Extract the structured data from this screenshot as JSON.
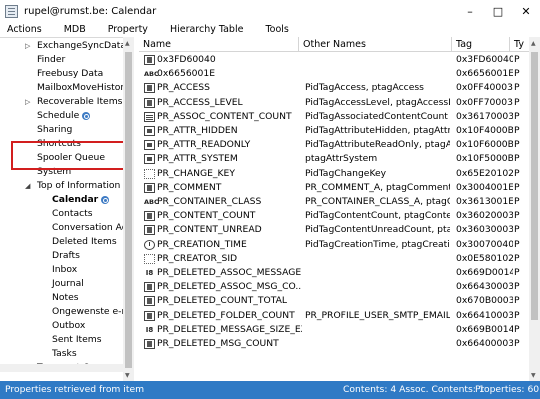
{
  "window": {
    "title": "rupel@rumst.be: Calendar",
    "icon": "mfcmapi-app-icon",
    "buttons": [
      "–",
      "□",
      "✕"
    ]
  },
  "menu": [
    "Actions",
    "MDB",
    "Property",
    "Hierarchy Table",
    "Tools"
  ],
  "tree": {
    "items": [
      {
        "label": "ExchangeSyncData",
        "indent": 1,
        "expander": "▷",
        "sync": false
      },
      {
        "label": "Finder",
        "indent": 1,
        "expander": "",
        "sync": false
      },
      {
        "label": "Freebusy Data",
        "indent": 1,
        "expander": "",
        "sync": false
      },
      {
        "label": "MailboxMoveHistory",
        "indent": 1,
        "expander": "",
        "sync": false
      },
      {
        "label": "Recoverable Items",
        "indent": 1,
        "expander": "▷",
        "sync": true
      },
      {
        "label": "Schedule",
        "indent": 1,
        "expander": "",
        "sync": true
      },
      {
        "label": "Sharing",
        "indent": 1,
        "expander": "",
        "sync": false
      },
      {
        "label": "Shortcuts",
        "indent": 1,
        "expander": "",
        "sync": false
      },
      {
        "label": "Spooler Queue",
        "indent": 1,
        "expander": "",
        "sync": false
      },
      {
        "label": "System",
        "indent": 1,
        "expander": "",
        "sync": false
      },
      {
        "label": "Top of Information S",
        "indent": 1,
        "expander": "◢",
        "sync": false
      },
      {
        "label": "Calendar",
        "indent": 2,
        "expander": "",
        "sync": true,
        "selected": true
      },
      {
        "label": "Contacts",
        "indent": 2,
        "expander": "",
        "sync": false
      },
      {
        "label": "Conversation Acti",
        "indent": 2,
        "expander": "",
        "sync": false
      },
      {
        "label": "Deleted Items",
        "indent": 2,
        "expander": "",
        "sync": false
      },
      {
        "label": "Drafts",
        "indent": 2,
        "expander": "",
        "sync": false
      },
      {
        "label": "Inbox",
        "indent": 2,
        "expander": "",
        "sync": false
      },
      {
        "label": "Journal",
        "indent": 2,
        "expander": "",
        "sync": false
      },
      {
        "label": "Notes",
        "indent": 2,
        "expander": "",
        "sync": false
      },
      {
        "label": "Ongewenste e-m",
        "indent": 2,
        "expander": "",
        "sync": false
      },
      {
        "label": "Outbox",
        "indent": 2,
        "expander": "",
        "sync": false
      },
      {
        "label": "Sent Items",
        "indent": 2,
        "expander": "",
        "sync": false
      },
      {
        "label": "Tasks",
        "indent": 2,
        "expander": "",
        "sync": false
      },
      {
        "label": "Transport Queue",
        "indent": 1,
        "expander": "",
        "sync": false
      }
    ]
  },
  "grid": {
    "columns": [
      "Name",
      "Other Names",
      "Tag",
      "Ty"
    ],
    "rows": [
      {
        "icon": "binary",
        "name": "0x3FD60040",
        "other": "",
        "tag": "0x3FD60040",
        "type": "P"
      },
      {
        "icon": "string",
        "name": "0x6656001E",
        "other": "",
        "tag": "0x6656001E",
        "type": "P"
      },
      {
        "icon": "binary",
        "name": "PR_ACCESS",
        "other": "PidTagAccess, ptagAccess",
        "tag": "0x0FF40003",
        "type": "P"
      },
      {
        "icon": "binary",
        "name": "PR_ACCESS_LEVEL",
        "other": "PidTagAccessLevel, ptagAccessLe...",
        "tag": "0x0FF70003",
        "type": "P"
      },
      {
        "icon": "list",
        "name": "PR_ASSOC_CONTENT_COUNT",
        "other": "PidTagAssociatedContentCount",
        "tag": "0x36170003",
        "type": "P"
      },
      {
        "icon": "bool",
        "name": "PR_ATTR_HIDDEN",
        "other": "PidTagAttributeHidden, ptagAttr...",
        "tag": "0x10F4000B",
        "type": "P"
      },
      {
        "icon": "bool",
        "name": "PR_ATTR_READONLY",
        "other": "PidTagAttributeReadOnly, ptagAt...",
        "tag": "0x10F6000B",
        "type": "P"
      },
      {
        "icon": "bool",
        "name": "PR_ATTR_SYSTEM",
        "other": "ptagAttrSystem",
        "tag": "0x10F5000B",
        "type": "P"
      },
      {
        "icon": "grid",
        "name": "PR_CHANGE_KEY",
        "other": "PidTagChangeKey",
        "tag": "0x65E20102",
        "type": "P"
      },
      {
        "icon": "binary",
        "name": "PR_COMMENT",
        "other": "PR_COMMENT_A, ptagComment...",
        "tag": "0x3004001E",
        "type": "P"
      },
      {
        "icon": "string",
        "name": "PR_CONTAINER_CLASS",
        "other": "PR_CONTAINER_CLASS_A, ptagC...",
        "tag": "0x3613001E",
        "type": "P"
      },
      {
        "icon": "binary",
        "name": "PR_CONTENT_COUNT",
        "other": "PidTagContentCount, ptagConte...",
        "tag": "0x36020003",
        "type": "P"
      },
      {
        "icon": "binary",
        "name": "PR_CONTENT_UNREAD",
        "other": "PidTagContentUnreadCount, pta...",
        "tag": "0x36030003",
        "type": "P"
      },
      {
        "icon": "time",
        "name": "PR_CREATION_TIME",
        "other": "PidTagCreationTime, ptagCreatio...",
        "tag": "0x30070040",
        "type": "P"
      },
      {
        "icon": "grid",
        "name": "PR_CREATOR_SID",
        "other": "",
        "tag": "0x0E580102",
        "type": "P"
      },
      {
        "icon": "int",
        "name": "PR_DELETED_ASSOC_MESSAGE...",
        "other": "",
        "tag": "0x669D0014",
        "type": "P"
      },
      {
        "icon": "binary",
        "name": "PR_DELETED_ASSOC_MSG_CO...",
        "other": "",
        "tag": "0x66430003",
        "type": "P"
      },
      {
        "icon": "binary",
        "name": "PR_DELETED_COUNT_TOTAL",
        "other": "",
        "tag": "0x670B0003",
        "type": "P"
      },
      {
        "icon": "binary",
        "name": "PR_DELETED_FOLDER_COUNT",
        "other": "PR_PROFILE_USER_SMTP_EMAIL_...",
        "tag": "0x66410003",
        "type": "P"
      },
      {
        "icon": "int",
        "name": "PR_DELETED_MESSAGE_SIZE_EX...",
        "other": "",
        "tag": "0x669B0014",
        "type": "P"
      },
      {
        "icon": "binary",
        "name": "PR_DELETED_MSG_COUNT",
        "other": "",
        "tag": "0x66400003",
        "type": "P"
      }
    ]
  },
  "status": {
    "left": "Properties retrieved from item",
    "mid": "Contents: 4 Assoc. Contents: 1",
    "right": "Properties: 60",
    "color": "#2f7ac5"
  }
}
